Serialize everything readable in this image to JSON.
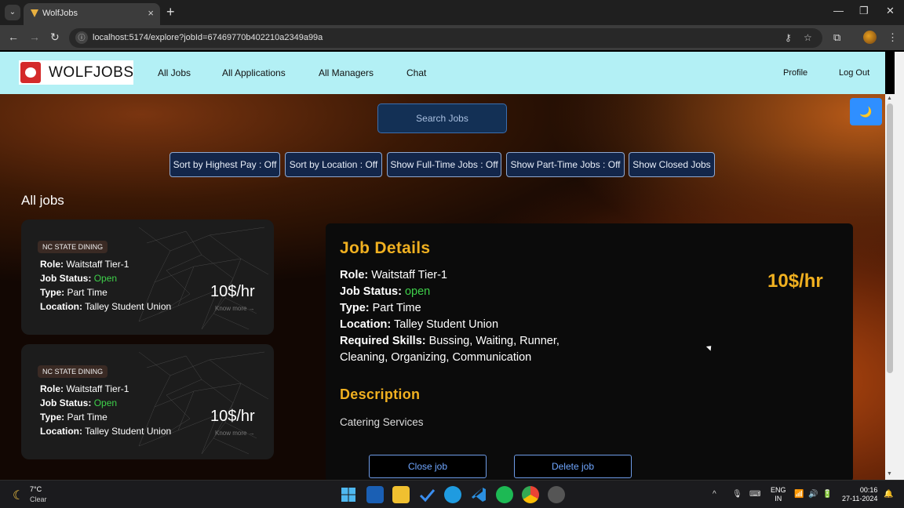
{
  "browser": {
    "tab_title": "WolfJobs",
    "url": "localhost:5174/explore?jobId=67469770b402210a2349a99a"
  },
  "header": {
    "logo_text": "WOLFJOBS",
    "nav": [
      "All Jobs",
      "All Applications",
      "All Managers",
      "Chat"
    ],
    "profile_label": "Profile",
    "logout_label": "Log Out"
  },
  "search": {
    "placeholder": "Search Jobs"
  },
  "theme_toggle_icon": "moon-icon",
  "filters": [
    "Sort by Highest Pay : Off",
    "Sort by Location : Off",
    "Show Full-Time Jobs : Off",
    "Show Part-Time Jobs : Off",
    "Show Closed Jobs"
  ],
  "jobs_heading": "All jobs",
  "jobs": [
    {
      "company": "NC STATE DINING",
      "role_label": "Role:",
      "role": "Waitstaff Tier-1",
      "status_label": "Job Status:",
      "status": "Open",
      "type_label": "Type:",
      "type": "Part Time",
      "location_label": "Location:",
      "location": "Talley Student Union",
      "pay": "10$/hr",
      "know_more": "Know more →"
    },
    {
      "company": "NC STATE DINING",
      "role_label": "Role:",
      "role": "Waitstaff Tier-1",
      "status_label": "Job Status:",
      "status": "Open",
      "type_label": "Type:",
      "type": "Part Time",
      "location_label": "Location:",
      "location": "Talley Student Union",
      "pay": "10$/hr",
      "know_more": "Know more →"
    }
  ],
  "details": {
    "heading": "Job Details",
    "role_label": "Role:",
    "role": "Waitstaff Tier-1",
    "status_label": "Job Status:",
    "status": "open",
    "type_label": "Type:",
    "type": "Part Time",
    "location_label": "Location:",
    "location": "Talley Student Union",
    "skills_label": "Required Skills:",
    "skills_line1": "Bussing, Waiting, Runner,",
    "skills_line2": "Cleaning, Organizing, Communication",
    "pay": "10$/hr",
    "description_heading": "Description",
    "description": "Catering Services",
    "close_button": "Close job",
    "delete_button": "Delete job"
  },
  "taskbar": {
    "temperature": "7°C",
    "condition": "Clear",
    "lang_line1": "ENG",
    "lang_line2": "IN",
    "time": "00:16",
    "date": "27-11-2024"
  }
}
